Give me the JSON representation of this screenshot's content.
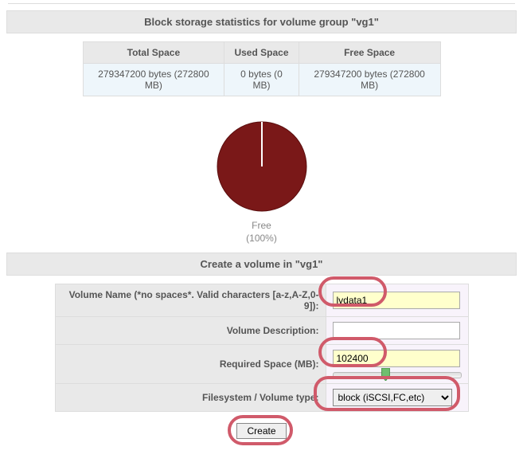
{
  "header": {
    "stats_title": "Block storage statistics for volume group \"vg1\""
  },
  "stats": {
    "cols": {
      "total": "Total Space",
      "used": "Used Space",
      "free": "Free Space"
    },
    "row": {
      "total": "279347200 bytes (272800 MB)",
      "used": "0 bytes (0 MB)",
      "free": "279347200 bytes (272800 MB)"
    }
  },
  "chart_data": {
    "type": "pie",
    "title": "",
    "series": [
      {
        "name": "Free",
        "value": 100,
        "color": "#7a1818"
      }
    ],
    "labels": {
      "below_name": "Free",
      "below_pct": "(100%)"
    }
  },
  "form": {
    "title": "Create a volume in \"vg1\"",
    "labels": {
      "name": "Volume Name (*no spaces*. Valid characters [a-z,A-Z,0-9]):",
      "desc": "Volume Description:",
      "space": "Required Space (MB):",
      "type": "Filesystem / Volume type:"
    },
    "values": {
      "name": "lvdata1",
      "desc": "",
      "space": "102400",
      "type": "block (iSCSI,FC,etc)"
    },
    "create_label": "Create"
  }
}
